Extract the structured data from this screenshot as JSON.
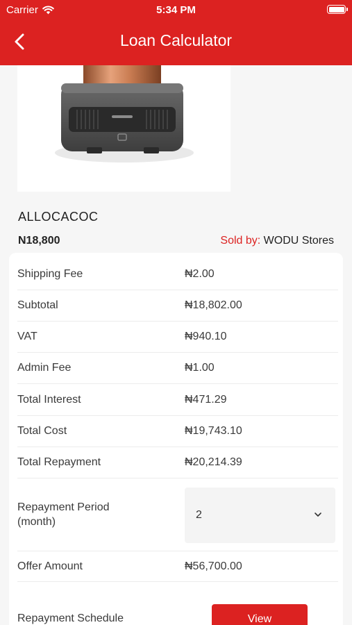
{
  "status": {
    "carrier": "Carrier",
    "time": "5:34 PM"
  },
  "nav": {
    "title": "Loan Calculator"
  },
  "product": {
    "name": "ALLOCACOC",
    "price": "N18,800",
    "sold_by_label": "Sold by:",
    "seller": "WODU Stores"
  },
  "summary": [
    {
      "label": "Shipping Fee",
      "value": "₦2.00"
    },
    {
      "label": "Subtotal",
      "value": "₦18,802.00"
    },
    {
      "label": "VAT",
      "value": "₦940.10"
    },
    {
      "label": "Admin Fee",
      "value": "₦1.00"
    },
    {
      "label": "Total Interest",
      "value": "₦471.29"
    },
    {
      "label": "Total Cost",
      "value": "₦19,743.10"
    },
    {
      "label": "Total Repayment",
      "value": "₦20,214.39"
    }
  ],
  "repayment_period": {
    "label_line1": "Repayment Period",
    "label_line2": "(month)",
    "selected": "2"
  },
  "offer": {
    "label": "Offer Amount",
    "value": "₦56,700.00"
  },
  "schedule": {
    "label": "Repayment Schedule",
    "button": "View"
  },
  "colors": {
    "brand": "#dc2221"
  }
}
